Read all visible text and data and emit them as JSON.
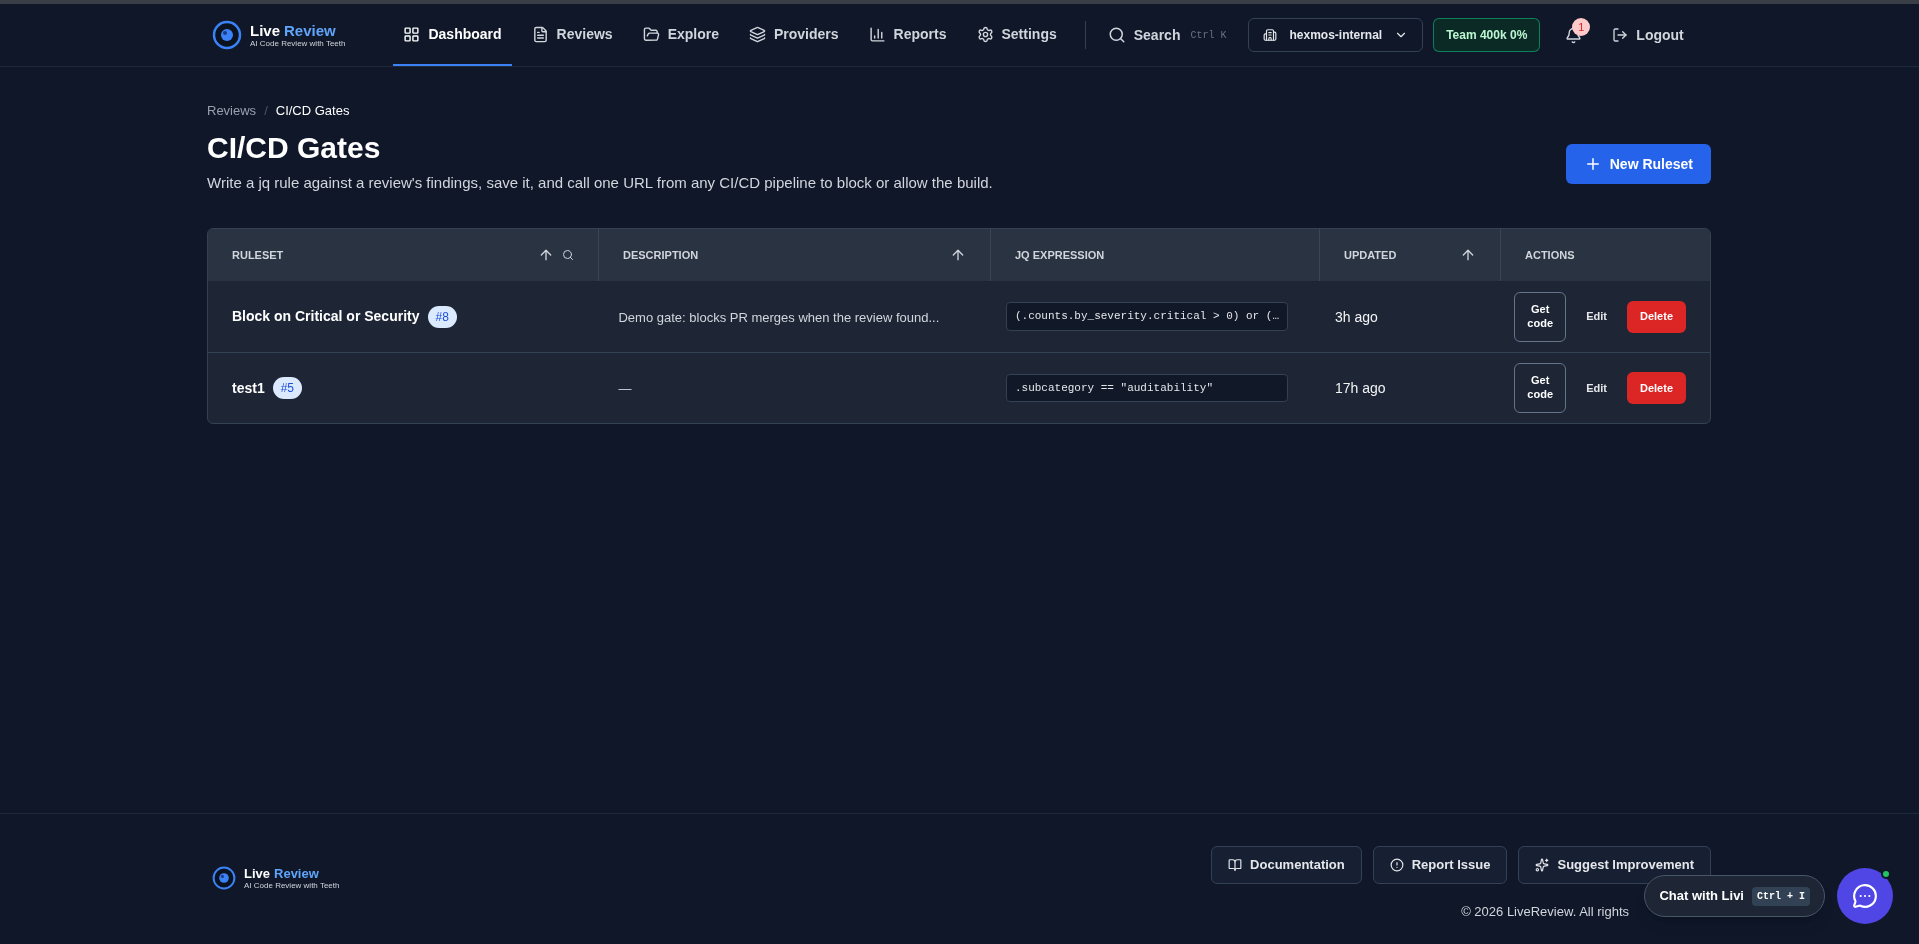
{
  "header": {
    "logo": {
      "word1": "Live",
      "word2": "Review",
      "tagline": "AI Code Review with Teeth"
    },
    "nav": [
      {
        "label": "Dashboard",
        "selected": true
      },
      {
        "label": "Reviews",
        "selected": false
      },
      {
        "label": "Explore",
        "selected": false
      },
      {
        "label": "Providers",
        "selected": false
      },
      {
        "label": "Reports",
        "selected": false
      },
      {
        "label": "Settings",
        "selected": false
      }
    ],
    "search": {
      "label": "Search",
      "shortcut": "Ctrl K"
    },
    "org": "hexmos-internal",
    "plan_badge": "Team 400k 0%",
    "notification_count": "1",
    "logout": "Logout"
  },
  "breadcrumb": {
    "separator": "/",
    "items": [
      {
        "label": "Reviews",
        "current": false
      },
      {
        "label": "CI/CD Gates",
        "current": true
      }
    ]
  },
  "page": {
    "title": "CI/CD Gates",
    "subtitle": "Write a jq rule against a review's findings, save it, and call one URL from any CI/CD pipeline to block or allow the build.",
    "primary_button": "New Ruleset"
  },
  "table": {
    "columns": [
      {
        "label": "RULESET",
        "sorted": true,
        "searchable": true
      },
      {
        "label": "DESCRIPTION",
        "sorted": true,
        "searchable": false
      },
      {
        "label": "JQ EXPRESSION",
        "sorted": false,
        "searchable": false
      },
      {
        "label": "UPDATED",
        "sorted": true,
        "searchable": false
      },
      {
        "label": "ACTIONS",
        "sorted": false,
        "searchable": false
      }
    ],
    "rows": [
      {
        "name": "Block on Critical or Security",
        "id": "#8",
        "description": "Demo gate: blocks PR merges when the review found...",
        "jq": "(.counts.by_severity.critical > 0) or (…",
        "updated": "3h ago",
        "actions": [
          {
            "kind": "outline",
            "label": "Get code"
          },
          {
            "kind": "ghost",
            "label": "Edit"
          },
          {
            "kind": "danger",
            "label": "Delete"
          }
        ]
      },
      {
        "name": "test1",
        "id": "#5",
        "description": "—",
        "jq": ".subcategory == \"auditability\"",
        "updated": "17h ago",
        "actions": [
          {
            "kind": "outline",
            "label": "Get code"
          },
          {
            "kind": "ghost",
            "label": "Edit"
          },
          {
            "kind": "danger",
            "label": "Delete"
          }
        ]
      }
    ]
  },
  "footer": {
    "logo": {
      "word1": "Live",
      "word2": "Review",
      "tagline": "AI Code Review with Teeth"
    },
    "links": [
      {
        "label": "Documentation"
      },
      {
        "label": "Report Issue"
      },
      {
        "label": "Suggest Improvement"
      }
    ],
    "copyright": "© 2026 LiveReview. All rights"
  },
  "chat": {
    "label": "Chat with Livi",
    "shortcut": "Ctrl + I",
    "online": true
  }
}
